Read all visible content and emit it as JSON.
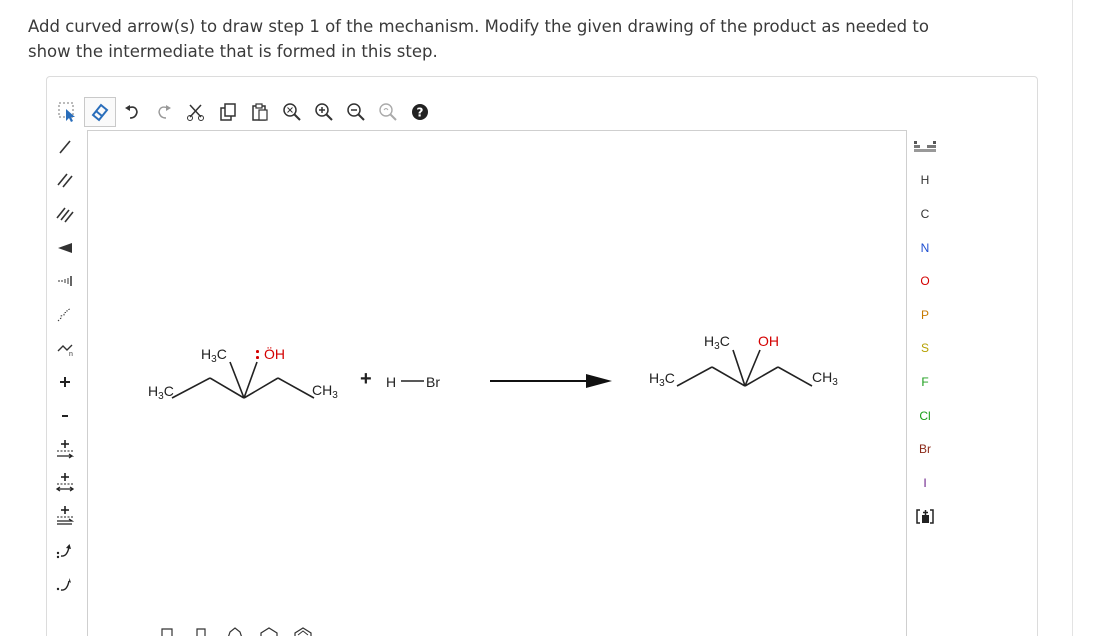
{
  "question": {
    "text": "Add curved arrow(s) to draw step 1 of the mechanism. Modify the given drawing of the product as needed to show the intermediate that is formed in this step."
  },
  "toolbar_top": {
    "items": [
      {
        "name": "select-icon"
      },
      {
        "name": "erase-icon"
      },
      {
        "name": "undo-icon"
      },
      {
        "name": "redo-icon"
      },
      {
        "name": "cut-icon"
      },
      {
        "name": "copy-icon"
      },
      {
        "name": "paste-icon"
      },
      {
        "name": "zoom-fit-icon"
      },
      {
        "name": "zoom-in-icon"
      },
      {
        "name": "zoom-out-icon"
      },
      {
        "name": "clean-icon"
      },
      {
        "name": "help-icon"
      }
    ],
    "selected": "erase-icon"
  },
  "toolbar_left": {
    "items": [
      "single-bond",
      "double-bond",
      "triple-bond",
      "wedge-bond",
      "hash-bond",
      "wavy-bond",
      "chain",
      "positive-charge",
      "negative-charge",
      "add-lone-pair",
      "add-radical",
      "add-electron",
      "curved-arrow-pair",
      "curved-arrow-single"
    ]
  },
  "toolbar_right": {
    "elements": [
      "H",
      "C",
      "N",
      "O",
      "P",
      "S",
      "F",
      "Cl",
      "Br",
      "I"
    ],
    "colors": {
      "H": "#333333",
      "C": "#333333",
      "N": "#1f4fd1",
      "O": "#d40000",
      "P": "#c77a00",
      "S": "#b5a100",
      "F": "#1a9e1a",
      "Cl": "#1a9e1a",
      "Br": "#8b2a1a",
      "I": "#6b1f8a"
    }
  },
  "reaction": {
    "reactant_labels": {
      "methyl_top": "H",
      "methyl_top_sub": "3",
      "methyl_top_c": "C",
      "oh": "ÖH",
      "methyl_left": "H",
      "methyl_left_sub": "3",
      "methyl_left_c": "C",
      "methyl_right": "CH",
      "methyl_right_sub": "3"
    },
    "plus": "+",
    "reagent": {
      "h": "H",
      "br": "Br"
    },
    "product_labels": {
      "methyl_top": "H",
      "methyl_top_sub": "3",
      "methyl_top_c": "C",
      "oh": "OH",
      "methyl_left": "H",
      "methyl_left_sub": "3",
      "methyl_left_c": "C",
      "methyl_right": "CH",
      "methyl_right_sub": "3"
    }
  }
}
